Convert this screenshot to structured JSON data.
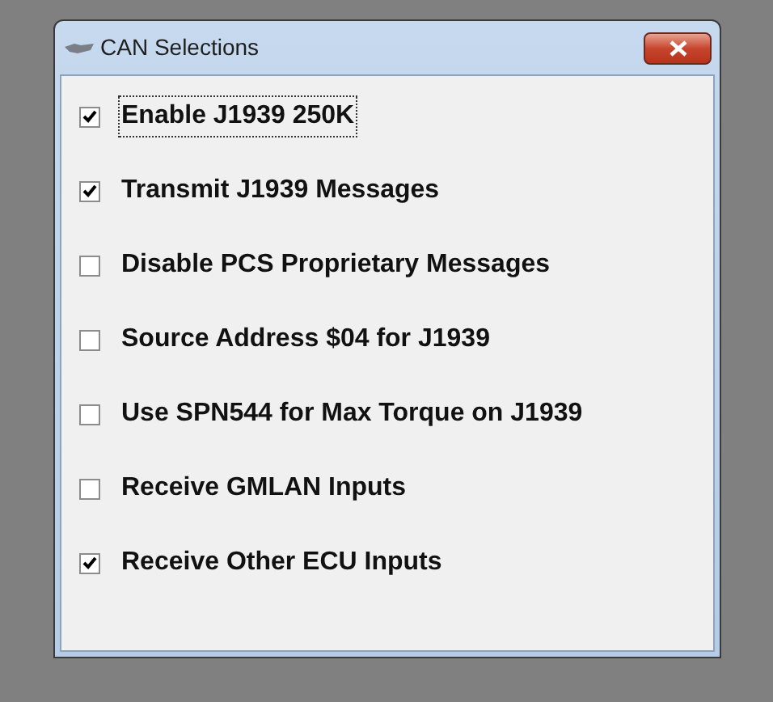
{
  "window": {
    "title": "CAN Selections"
  },
  "options": [
    {
      "label": "Enable J1939 250K",
      "checked": true,
      "focused": true
    },
    {
      "label": "Transmit J1939 Messages",
      "checked": true,
      "focused": false
    },
    {
      "label": "Disable PCS Proprietary Messages",
      "checked": false,
      "focused": false
    },
    {
      "label": "Source Address $04 for J1939",
      "checked": false,
      "focused": false
    },
    {
      "label": "Use SPN544 for Max Torque on J1939",
      "checked": false,
      "focused": false
    },
    {
      "label": "Receive GMLAN Inputs",
      "checked": false,
      "focused": false
    },
    {
      "label": "Receive Other ECU Inputs",
      "checked": true,
      "focused": false
    }
  ]
}
